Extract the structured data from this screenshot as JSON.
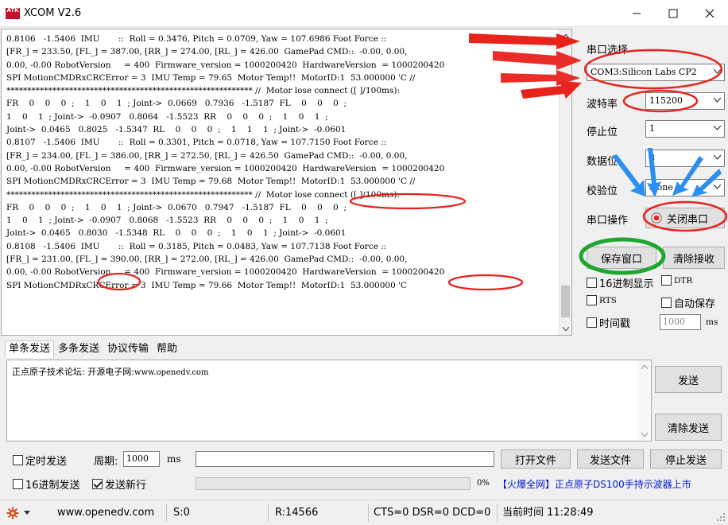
{
  "window": {
    "logo_text": "ATK",
    "title": "XCOM V2.6"
  },
  "receive": {
    "lines": [
      "0.8106   -1.5406  IMU       ::  Roll = 0.3476, Pitch = 0.0709, Yaw = 107.6986 Foot Force ::",
      "[FR_] = 233.50, [FL_] = 387.00, [RR_] = 274.00, [RL_] = 426.00  GamePad CMD::  -0.00, 0.00,",
      "0.00, -0.00 RobotVersion     = 400  Firmware_version = 1000200420  HardwareVersion  = 1000200420",
      "SPI MotionCMDRxCRCError = 3  IMU Temp = 79.65  Motor Temp!!  MotorID:1  53.000000 'C //",
      "*********************************************************** //  Motor lose connect ([ ]/100ms):",
      "FR    0    0    0  ;    1    0    1  ; Joint->  0.0669   0.7936   -1.5187  FL    0    0    0  ;",
      "1    0    1  ; Joint->  -0.0907   0.8064   -1.5523  RR    0    0    0  ;    1    0    1  ;",
      "Joint->  0.0465   0.8025   -1.5347  RL    0    0    0  ;    1    1    1  ; Joint->  -0.0601",
      "0.8107   -1.5406  IMU       ::  Roll = 0.3301, Pitch = 0.0718, Yaw = 107.7150 Foot Force ::",
      "[FR_] = 234.00, [FL_] = 386.00, [RR_] = 272.50, [RL_] = 426.50  GamePad CMD::  -0.00, 0.00,",
      "0.00, -0.00 RobotVersion     = 400  Firmware_version = 1000200420  HardwareVersion  = 1000200420",
      "SPI MotionCMDRxCRCError = 3  IMU Temp = 79.68  Motor Temp!!  MotorID:1  53.000000 'C //",
      "*********************************************************** //  Motor lose connect ([ ]/100ms):",
      "FR    0    0    0  ;    1    0    1  ; Joint->  0.0670   0.7947   -1.5187  FL    0    0    0  ;",
      "1    0    1  ; Joint->  -0.0907   0.8068   -1.5523  RR    0    0    0  ;    1    0    1  ;",
      "Joint->  0.0465   0.8030   -1.5348  RL    0    0    0  ;    1    0    1  ; Joint->  -0.0601",
      "0.8108   -1.5406  IMU       ::  Roll = 0.3185, Pitch = 0.0483, Yaw = 107.7138 Foot Force ::",
      "[FR_] = 231.00, [FL_] = 390.00, [RR_] = 272.00, [RL_] = 426.00  GamePad CMD::  -0.00, 0.00,",
      "0.00, -0.00 RobotVersion     = 400  Firmware_version = 1000200420  HardwareVersion  = 1000200420",
      "SPI MotionCMDRxCRCError = 3  IMU Temp = 79.66  Motor Temp!!  MotorID:1  53.000000 'C"
    ]
  },
  "right_panel": {
    "port_label": "串口选择",
    "port_value": "COM3:Silicon Labs CP2",
    "baud_label": "波特率",
    "baud_value": "115200",
    "stop_label": "停止位",
    "stop_value": "1",
    "data_label": "数据位",
    "data_value": "8",
    "parity_label": "校验位",
    "parity_value": "None",
    "op_label": "串口操作",
    "close_port_label": "关闭串口",
    "save_window_label": "保存窗口",
    "clear_recv_label": "清除接收",
    "hex_display_label": "16进制显示",
    "dtr_label": "DTR",
    "rts_label": "RTS",
    "auto_save_label": "自动保存",
    "timestamp_label": "时间戳",
    "timestamp_value": "1000",
    "timestamp_unit": "ms"
  },
  "tabs": [
    "单条发送",
    "多条发送",
    "协议传输",
    "帮助"
  ],
  "send": {
    "text_cn": "正点原子技术论坛: 开源电子网:",
    "text_url": "www.openedv.com",
    "send_button": "发送",
    "clear_send_button": "清除发送"
  },
  "bottom": {
    "timed_send_label": "定时发送",
    "period_label": "周期:",
    "period_value": "1000",
    "period_unit": "ms",
    "open_file_button": "打开文件",
    "send_file_button": "发送文件",
    "stop_send_button": "停止发送",
    "hex_send_label": "16进制发送",
    "newline_label": "发送新行",
    "progress_percent": "0%",
    "progress_fraction": 0,
    "promo_text": "【火爆全网】正点原子DS100手持示波器上市"
  },
  "statusbar": {
    "url": "www.openedv.com",
    "sent": "S:0",
    "received": "R:14566",
    "lines": "CTS=0 DSR=0 DCD=0",
    "time": "当前时间 11:28:49"
  },
  "colors": {
    "annotation_red": "#e8231e",
    "annotation_blue": "#2a8ff0",
    "annotation_green": "#20a530",
    "promo_blue": "#0019c8",
    "progress_green": "#06b025"
  }
}
